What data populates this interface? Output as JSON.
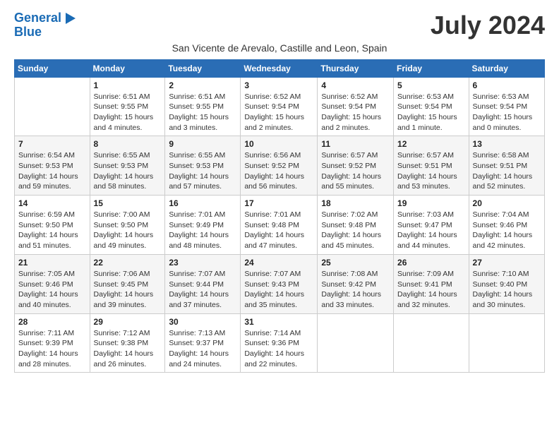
{
  "header": {
    "logo_line1": "General",
    "logo_line2": "Blue",
    "month_title": "July 2024",
    "subtitle": "San Vicente de Arevalo, Castille and Leon, Spain"
  },
  "weekdays": [
    "Sunday",
    "Monday",
    "Tuesday",
    "Wednesday",
    "Thursday",
    "Friday",
    "Saturday"
  ],
  "weeks": [
    [
      {
        "day": "",
        "detail": ""
      },
      {
        "day": "1",
        "detail": "Sunrise: 6:51 AM\nSunset: 9:55 PM\nDaylight: 15 hours\nand 4 minutes."
      },
      {
        "day": "2",
        "detail": "Sunrise: 6:51 AM\nSunset: 9:55 PM\nDaylight: 15 hours\nand 3 minutes."
      },
      {
        "day": "3",
        "detail": "Sunrise: 6:52 AM\nSunset: 9:54 PM\nDaylight: 15 hours\nand 2 minutes."
      },
      {
        "day": "4",
        "detail": "Sunrise: 6:52 AM\nSunset: 9:54 PM\nDaylight: 15 hours\nand 2 minutes."
      },
      {
        "day": "5",
        "detail": "Sunrise: 6:53 AM\nSunset: 9:54 PM\nDaylight: 15 hours\nand 1 minute."
      },
      {
        "day": "6",
        "detail": "Sunrise: 6:53 AM\nSunset: 9:54 PM\nDaylight: 15 hours\nand 0 minutes."
      }
    ],
    [
      {
        "day": "7",
        "detail": "Sunrise: 6:54 AM\nSunset: 9:53 PM\nDaylight: 14 hours\nand 59 minutes."
      },
      {
        "day": "8",
        "detail": "Sunrise: 6:55 AM\nSunset: 9:53 PM\nDaylight: 14 hours\nand 58 minutes."
      },
      {
        "day": "9",
        "detail": "Sunrise: 6:55 AM\nSunset: 9:53 PM\nDaylight: 14 hours\nand 57 minutes."
      },
      {
        "day": "10",
        "detail": "Sunrise: 6:56 AM\nSunset: 9:52 PM\nDaylight: 14 hours\nand 56 minutes."
      },
      {
        "day": "11",
        "detail": "Sunrise: 6:57 AM\nSunset: 9:52 PM\nDaylight: 14 hours\nand 55 minutes."
      },
      {
        "day": "12",
        "detail": "Sunrise: 6:57 AM\nSunset: 9:51 PM\nDaylight: 14 hours\nand 53 minutes."
      },
      {
        "day": "13",
        "detail": "Sunrise: 6:58 AM\nSunset: 9:51 PM\nDaylight: 14 hours\nand 52 minutes."
      }
    ],
    [
      {
        "day": "14",
        "detail": "Sunrise: 6:59 AM\nSunset: 9:50 PM\nDaylight: 14 hours\nand 51 minutes."
      },
      {
        "day": "15",
        "detail": "Sunrise: 7:00 AM\nSunset: 9:50 PM\nDaylight: 14 hours\nand 49 minutes."
      },
      {
        "day": "16",
        "detail": "Sunrise: 7:01 AM\nSunset: 9:49 PM\nDaylight: 14 hours\nand 48 minutes."
      },
      {
        "day": "17",
        "detail": "Sunrise: 7:01 AM\nSunset: 9:48 PM\nDaylight: 14 hours\nand 47 minutes."
      },
      {
        "day": "18",
        "detail": "Sunrise: 7:02 AM\nSunset: 9:48 PM\nDaylight: 14 hours\nand 45 minutes."
      },
      {
        "day": "19",
        "detail": "Sunrise: 7:03 AM\nSunset: 9:47 PM\nDaylight: 14 hours\nand 44 minutes."
      },
      {
        "day": "20",
        "detail": "Sunrise: 7:04 AM\nSunset: 9:46 PM\nDaylight: 14 hours\nand 42 minutes."
      }
    ],
    [
      {
        "day": "21",
        "detail": "Sunrise: 7:05 AM\nSunset: 9:46 PM\nDaylight: 14 hours\nand 40 minutes."
      },
      {
        "day": "22",
        "detail": "Sunrise: 7:06 AM\nSunset: 9:45 PM\nDaylight: 14 hours\nand 39 minutes."
      },
      {
        "day": "23",
        "detail": "Sunrise: 7:07 AM\nSunset: 9:44 PM\nDaylight: 14 hours\nand 37 minutes."
      },
      {
        "day": "24",
        "detail": "Sunrise: 7:07 AM\nSunset: 9:43 PM\nDaylight: 14 hours\nand 35 minutes."
      },
      {
        "day": "25",
        "detail": "Sunrise: 7:08 AM\nSunset: 9:42 PM\nDaylight: 14 hours\nand 33 minutes."
      },
      {
        "day": "26",
        "detail": "Sunrise: 7:09 AM\nSunset: 9:41 PM\nDaylight: 14 hours\nand 32 minutes."
      },
      {
        "day": "27",
        "detail": "Sunrise: 7:10 AM\nSunset: 9:40 PM\nDaylight: 14 hours\nand 30 minutes."
      }
    ],
    [
      {
        "day": "28",
        "detail": "Sunrise: 7:11 AM\nSunset: 9:39 PM\nDaylight: 14 hours\nand 28 minutes."
      },
      {
        "day": "29",
        "detail": "Sunrise: 7:12 AM\nSunset: 9:38 PM\nDaylight: 14 hours\nand 26 minutes."
      },
      {
        "day": "30",
        "detail": "Sunrise: 7:13 AM\nSunset: 9:37 PM\nDaylight: 14 hours\nand 24 minutes."
      },
      {
        "day": "31",
        "detail": "Sunrise: 7:14 AM\nSunset: 9:36 PM\nDaylight: 14 hours\nand 22 minutes."
      },
      {
        "day": "",
        "detail": ""
      },
      {
        "day": "",
        "detail": ""
      },
      {
        "day": "",
        "detail": ""
      }
    ]
  ]
}
